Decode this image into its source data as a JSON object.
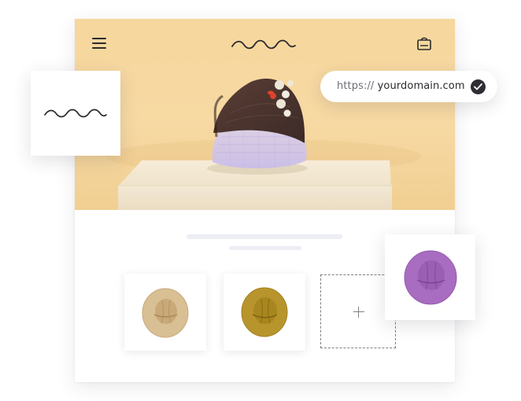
{
  "domain": {
    "protocol": "https://",
    "name": "yourdomain.com",
    "verified": true
  },
  "header": {
    "menu_icon": "hamburger-menu-icon",
    "logo_icon": "wave-logo-icon",
    "cart_icon": "shopping-bag-icon"
  },
  "hero": {
    "image": "hat-on-pedestal-photo"
  },
  "product_thumbnails": [
    {
      "name": "tan-hat",
      "color": "#d8bf94"
    },
    {
      "name": "mustard-hat",
      "color": "#b8952c"
    }
  ],
  "add_product": {
    "icon": "plus-icon"
  },
  "featured_product": {
    "name": "purple-hat",
    "color": "#a86cc0"
  },
  "colors": {
    "hero_background": "#f6d79d",
    "dark": "#2b2b2b",
    "placeholder": "#eceef4"
  }
}
